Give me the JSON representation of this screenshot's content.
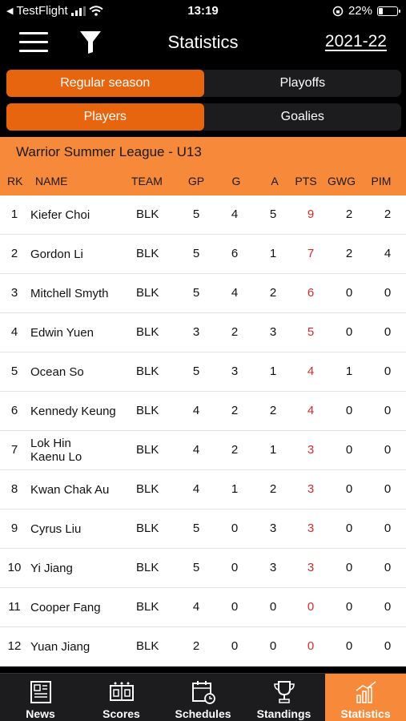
{
  "status": {
    "back_app": "TestFlight",
    "time": "13:19",
    "battery": "22%",
    "battery_level": 0.22
  },
  "nav": {
    "title": "Statistics",
    "season": "2021-22",
    "menu_icon": "hamburger-menu-icon",
    "filter_icon": "filter-icon"
  },
  "segments": {
    "type": {
      "left": "Regular season",
      "right": "Playoffs",
      "selected": "left"
    },
    "category": {
      "left": "Players",
      "right": "Goalies",
      "selected": "left"
    }
  },
  "league": {
    "name": "Warrior Summer League - U13"
  },
  "columns": {
    "rk": "RK",
    "name": "NAME",
    "team": "TEAM",
    "gp": "GP",
    "g": "G",
    "a": "A",
    "pts": "PTS",
    "gwg": "GWG",
    "pim": "PIM"
  },
  "players": [
    {
      "rk": "1",
      "name": "Kiefer Choi",
      "team": "BLK",
      "gp": "5",
      "g": "4",
      "a": "5",
      "pts": "9",
      "gwg": "2",
      "pim": "2"
    },
    {
      "rk": "2",
      "name": "Gordon Li",
      "team": "BLK",
      "gp": "5",
      "g": "6",
      "a": "1",
      "pts": "7",
      "gwg": "2",
      "pim": "4"
    },
    {
      "rk": "3",
      "name": "Mitchell Smyth",
      "team": "BLK",
      "gp": "5",
      "g": "4",
      "a": "2",
      "pts": "6",
      "gwg": "0",
      "pim": "0"
    },
    {
      "rk": "4",
      "name": "Edwin Yuen",
      "team": "BLK",
      "gp": "3",
      "g": "2",
      "a": "3",
      "pts": "5",
      "gwg": "0",
      "pim": "0"
    },
    {
      "rk": "5",
      "name": "Ocean So",
      "team": "BLK",
      "gp": "5",
      "g": "3",
      "a": "1",
      "pts": "4",
      "gwg": "1",
      "pim": "0"
    },
    {
      "rk": "6",
      "name": "Kennedy Keung",
      "team": "BLK",
      "gp": "4",
      "g": "2",
      "a": "2",
      "pts": "4",
      "gwg": "0",
      "pim": "0"
    },
    {
      "rk": "7",
      "name": "Lok Hin\nKaenu Lo",
      "team": "BLK",
      "gp": "4",
      "g": "2",
      "a": "1",
      "pts": "3",
      "gwg": "0",
      "pim": "0"
    },
    {
      "rk": "8",
      "name": "Kwan Chak Au",
      "team": "BLK",
      "gp": "4",
      "g": "1",
      "a": "2",
      "pts": "3",
      "gwg": "0",
      "pim": "0"
    },
    {
      "rk": "9",
      "name": "Cyrus Liu",
      "team": "BLK",
      "gp": "5",
      "g": "0",
      "a": "3",
      "pts": "3",
      "gwg": "0",
      "pim": "0"
    },
    {
      "rk": "10",
      "name": "Yi Jiang",
      "team": "BLK",
      "gp": "5",
      "g": "0",
      "a": "3",
      "pts": "3",
      "gwg": "0",
      "pim": "0"
    },
    {
      "rk": "11",
      "name": "Cooper Fang",
      "team": "BLK",
      "gp": "4",
      "g": "0",
      "a": "0",
      "pts": "0",
      "gwg": "0",
      "pim": "0"
    },
    {
      "rk": "12",
      "name": "Yuan Jiang",
      "team": "BLK",
      "gp": "2",
      "g": "0",
      "a": "0",
      "pts": "0",
      "gwg": "0",
      "pim": "0"
    }
  ],
  "tabs": [
    {
      "label": "News",
      "icon": "newspaper-icon",
      "active": false
    },
    {
      "label": "Scores",
      "icon": "scoreboard-icon",
      "active": false
    },
    {
      "label": "Schedules",
      "icon": "calendar-clock-icon",
      "active": false
    },
    {
      "label": "Standings",
      "icon": "trophy-icon",
      "active": false
    },
    {
      "label": "Statistics",
      "icon": "bar-chart-icon",
      "active": true
    }
  ],
  "colors": {
    "accent_orange": "#e8650f",
    "header_orange": "#f7893a",
    "points_red": "#d42a2a",
    "background": "#000000"
  }
}
